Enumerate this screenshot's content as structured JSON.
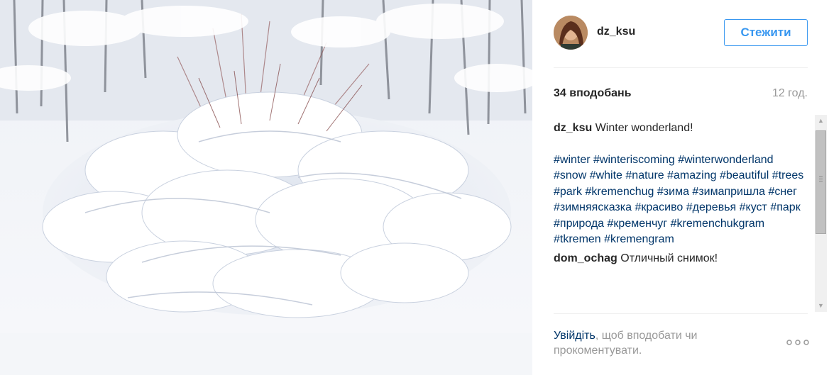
{
  "post": {
    "image_alt": "Snow-covered bush in a winter forest",
    "username": "dz_ksu",
    "follow_label": "Стежити",
    "likes": "34 вподобань",
    "time": "12 год."
  },
  "caption": {
    "username": "dz_ksu",
    "text": "Winter wonderland!",
    "tags": [
      "#winter",
      "#winteriscoming",
      "#winterwonderland",
      "#snow",
      "#white",
      "#nature",
      "#amazing",
      "#beautiful",
      "#trees",
      "#park",
      "#kremenchug",
      "#зима",
      "#зимапришла",
      "#снег",
      "#зимняясказка",
      "#красиво",
      "#деревья",
      "#куст",
      "#парк",
      "#природа",
      "#кременчуг",
      "#kremenchukgram",
      "#tkremen",
      "#kremengram"
    ]
  },
  "comments": [
    {
      "username": "dom_ochag",
      "text": "Отличный снимок!"
    }
  ],
  "footer": {
    "login_link": "Увійдіть",
    "login_text": ", щоб вподобати чи прокоментувати."
  },
  "icons": {
    "scroll_up": "scroll-up-arrow",
    "scroll_down": "scroll-down-arrow",
    "more": "more-options-dots"
  },
  "colors": {
    "follow_blue": "#3897f0",
    "link_navy": "#003569",
    "muted_gray": "#999999"
  }
}
